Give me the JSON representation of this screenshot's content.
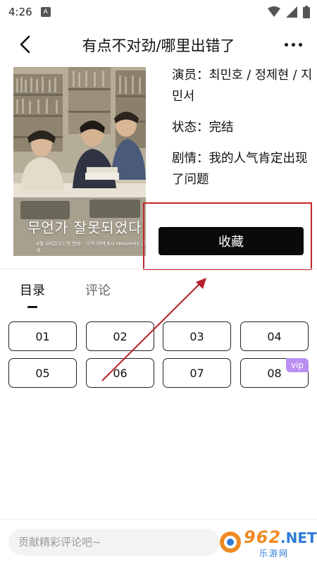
{
  "status": {
    "time": "4:26",
    "app_badge": "A"
  },
  "header": {
    "title": "有点不对劲/哪里出错了"
  },
  "poster": {
    "overlay_text": "무언가 잘못되었다",
    "small_text": "4월 16일(수) 첫 방송 · 수목 저녁 6시 Heavenly 공개"
  },
  "info": {
    "cast": "演员：최민호 / 정제현 / 지민서",
    "status": "状态：完结",
    "plot": "剧情：我的人气肯定出现了问题"
  },
  "favorite_label": "收藏",
  "tabs": [
    {
      "label": "目录",
      "active": true
    },
    {
      "label": "评论",
      "active": false
    }
  ],
  "episodes": [
    {
      "label": "01"
    },
    {
      "label": "02"
    },
    {
      "label": "03"
    },
    {
      "label": "04"
    },
    {
      "label": "05"
    },
    {
      "label": "06"
    },
    {
      "label": "07"
    },
    {
      "label": "08",
      "badge": "vip"
    }
  ],
  "comment": {
    "placeholder": "贡献精彩评论吧~"
  },
  "watermark": {
    "brand": "962",
    "net": ".NET",
    "sub": "乐游网"
  },
  "colors": {
    "accent": "#0a0a0a",
    "vip": "#b98ff0",
    "highlight": "#c1272d",
    "watermark_orange": "#f08a24",
    "watermark_blue": "#2b7bd6"
  }
}
